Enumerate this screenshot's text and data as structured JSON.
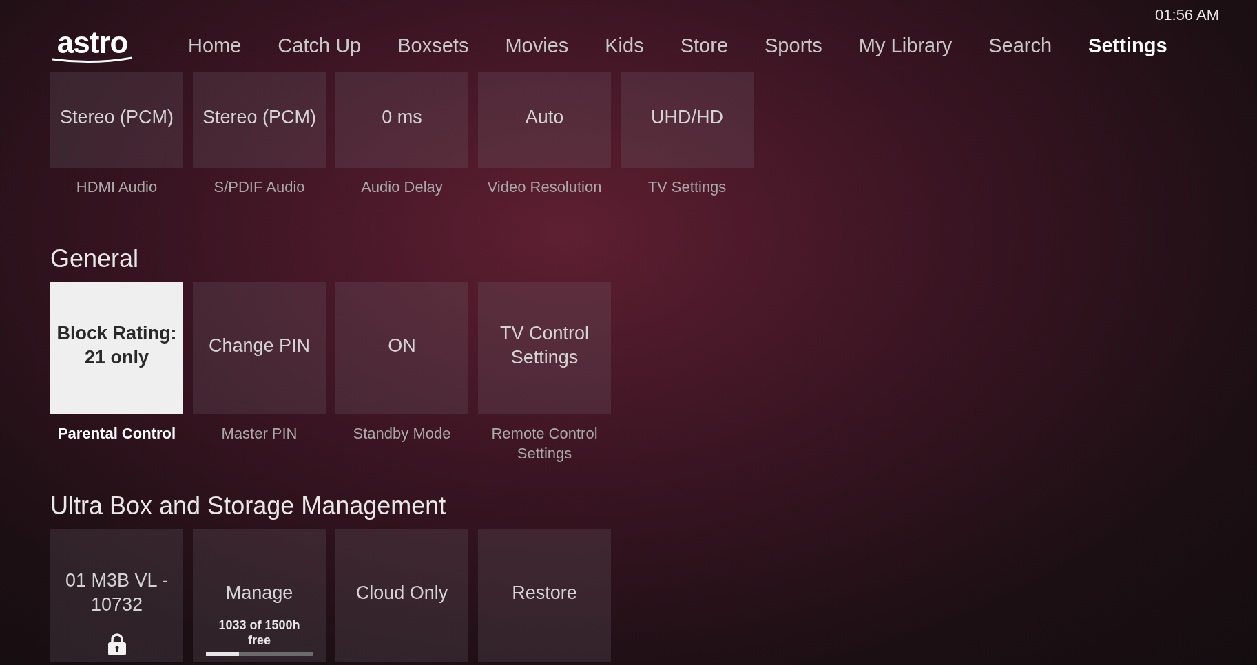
{
  "clock": "01:56 AM",
  "logo": "astro",
  "nav": [
    {
      "label": "Home",
      "selected": false
    },
    {
      "label": "Catch Up",
      "selected": false
    },
    {
      "label": "Boxsets",
      "selected": false
    },
    {
      "label": "Movies",
      "selected": false
    },
    {
      "label": "Kids",
      "selected": false
    },
    {
      "label": "Store",
      "selected": false
    },
    {
      "label": "Sports",
      "selected": false
    },
    {
      "label": "My Library",
      "selected": false
    },
    {
      "label": "Search",
      "selected": false
    },
    {
      "label": "Settings",
      "selected": true
    }
  ],
  "sections": [
    {
      "tiles": [
        {
          "kind": "plain",
          "value": "Stereo (PCM)",
          "caption": "HDMI Audio",
          "selected": false
        },
        {
          "kind": "plain",
          "value": "Stereo (PCM)",
          "caption": "S/PDIF Audio",
          "selected": false
        },
        {
          "kind": "plain",
          "value": "0 ms",
          "caption": "Audio Delay",
          "selected": false
        },
        {
          "kind": "plain",
          "value": "Auto",
          "caption": "Video Resolution",
          "selected": false
        },
        {
          "kind": "plain",
          "value": "UHD/HD",
          "caption": "TV Settings",
          "selected": false
        }
      ]
    },
    {
      "title": "General",
      "tiles": [
        {
          "kind": "plain",
          "value": "Block Rating: 21 only",
          "caption": "Parental Control",
          "selected": true
        },
        {
          "kind": "plain",
          "value": "Change PIN",
          "caption": "Master PIN",
          "selected": false
        },
        {
          "kind": "plain",
          "value": "ON",
          "caption": "Standby Mode",
          "selected": false
        },
        {
          "kind": "plain",
          "value": "TV Control Settings",
          "caption": "Remote Control Settings",
          "selected": false
        }
      ]
    },
    {
      "title": "Ultra Box and Storage Management",
      "tiles": [
        {
          "kind": "locked",
          "value": "01 M3B VL - 10732",
          "selected": false
        },
        {
          "kind": "storage",
          "value": "Manage",
          "note": "1033 of 1500h free",
          "level": 0.31,
          "selected": false
        },
        {
          "kind": "plain",
          "value": "Cloud Only",
          "selected": false
        },
        {
          "kind": "plain",
          "value": "Restore",
          "selected": false
        }
      ]
    }
  ]
}
